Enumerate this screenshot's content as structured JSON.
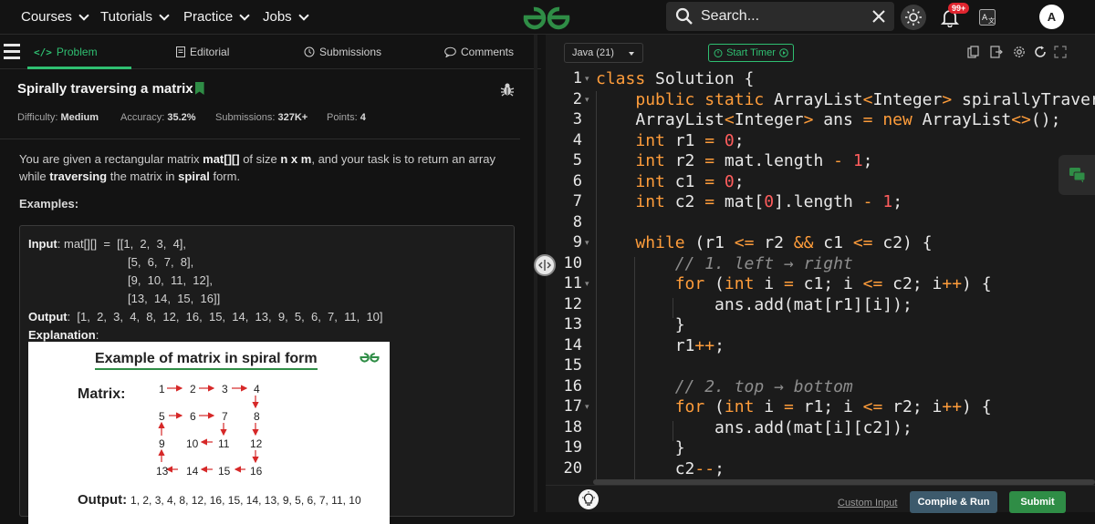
{
  "topnav": {
    "items": [
      {
        "label": "Courses"
      },
      {
        "label": "Tutorials"
      },
      {
        "label": "Practice"
      },
      {
        "label": "Jobs"
      }
    ],
    "search_placeholder": "Search...",
    "notification_badge": "99+",
    "avatar_letter": "A"
  },
  "problem_tabs": [
    {
      "label": "Problem",
      "icon": "code-icon",
      "active": true
    },
    {
      "label": "Editorial",
      "icon": "document-icon"
    },
    {
      "label": "Submissions",
      "icon": "clock-icon"
    },
    {
      "label": "Comments",
      "icon": "comment-icon"
    }
  ],
  "problem": {
    "title": "Spirally traversing a matrix",
    "difficulty_label": "Difficulty:",
    "difficulty": "Medium",
    "accuracy_label": "Accuracy:",
    "accuracy": "35.2%",
    "submissions_label": "Submissions:",
    "submissions": "327K+",
    "points_label": "Points:",
    "points": "4",
    "description": {
      "p1": "You are given a rectangular matrix ",
      "b1": "mat[][]",
      "p2": " of size ",
      "b2": "n x m",
      "p3": ", and your task is to return an array while ",
      "b3": "traversing",
      "p4": " the matrix in ",
      "b4": "spiral",
      "p5": " form."
    },
    "examples_heading": "Examples:",
    "example": {
      "input_label": "Input",
      "input_lines": [
        ": mat[][]  =  [[1,  2,  3,  4],",
        "[5,  6,  7,  8],",
        "[9,  10,  11,  12],",
        "[13,  14,  15,  16]]"
      ],
      "output_label": "Output",
      "output_value": ":  [1,  2,  3,  4,  8,  12,  16,  15,  14,  13,  9,  5,  6,  7,  11,  10]",
      "explanation_label": "Explanation",
      "explanation_colon": ":"
    },
    "figure": {
      "title": "Example of matrix in spiral form",
      "matrix_label": "Matrix:",
      "cells": [
        "1",
        "2",
        "3",
        "4",
        "5",
        "6",
        "7",
        "8",
        "9",
        "10",
        "11",
        "12",
        "13",
        "14",
        "15",
        "16"
      ],
      "output_label": "Output:",
      "output_value": "1, 2, 3, 4, 8, 12, 16, 15, 14, 13, 9, 5, 6, 7, 11, 10"
    }
  },
  "editor": {
    "language": "Java (21)",
    "timer_label": "Start Timer",
    "line_numbers": [
      "1",
      "2",
      "3",
      "4",
      "5",
      "6",
      "7",
      "8",
      "9",
      "10",
      "11",
      "12",
      "13",
      "14",
      "15",
      "16",
      "17",
      "18",
      "19",
      "20"
    ],
    "custom_input": "Custom Input",
    "compile_run": "Compile & Run",
    "submit": "Submit"
  },
  "colors": {
    "accent_green": "#2fbf71",
    "submit_green": "#2f8d46",
    "compile_blue": "#3d5a6c",
    "keyword_orange": "#ff9d3b",
    "number_red": "#ff5d5d"
  }
}
